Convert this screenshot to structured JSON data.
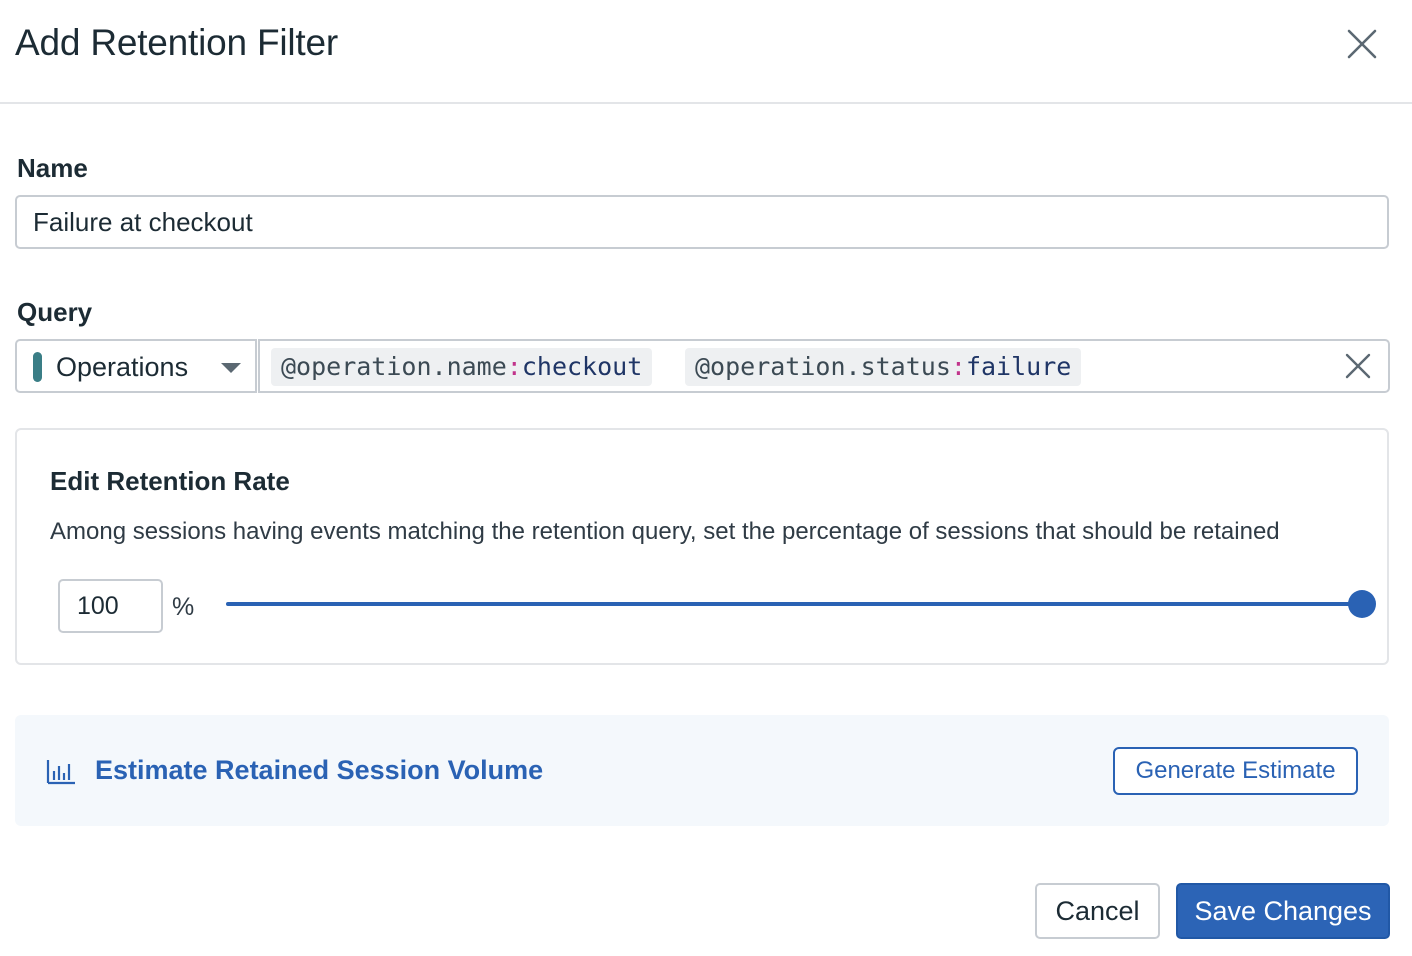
{
  "dialog": {
    "title": "Add Retention Filter"
  },
  "name_field": {
    "label": "Name",
    "value": "Failure at checkout"
  },
  "query": {
    "label": "Query",
    "source": "Operations",
    "source_color": "#3a7e86",
    "terms": [
      {
        "key": "@operation.name",
        "separator": ":",
        "value": "checkout"
      },
      {
        "key": "@operation.status",
        "separator": ":",
        "value": "failure"
      }
    ]
  },
  "retention_rate": {
    "title": "Edit Retention Rate",
    "description": "Among sessions having events matching the retention query, set the percentage of sessions that should be retained",
    "value": "100",
    "unit": "%",
    "slider_percent": 100
  },
  "estimate": {
    "icon": "bar-chart-icon",
    "title": "Estimate Retained Session Volume",
    "button_label": "Generate Estimate"
  },
  "footer": {
    "cancel_label": "Cancel",
    "save_label": "Save Changes"
  },
  "colors": {
    "accent": "#2a62b4",
    "primary_button": "#2c64b6"
  }
}
